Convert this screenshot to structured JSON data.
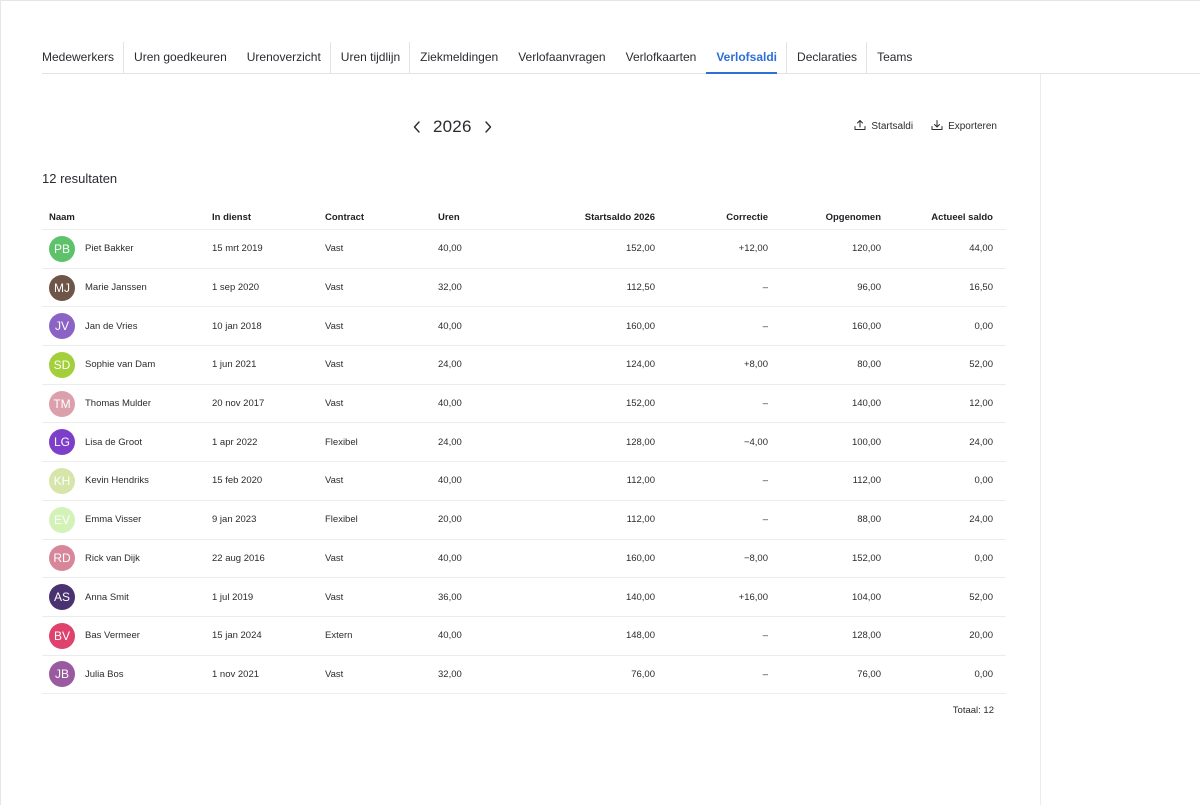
{
  "tabs": [
    {
      "label": "Medewerkers",
      "active": false,
      "separator": true
    },
    {
      "label": "Uren goedkeuren",
      "active": false,
      "separator": false
    },
    {
      "label": "Urenoverzicht",
      "active": false,
      "separator": true
    },
    {
      "label": "Uren tijdlijn",
      "active": false,
      "separator": true
    },
    {
      "label": "Ziekmeldingen",
      "active": false,
      "separator": false
    },
    {
      "label": "Verlofaanvragen",
      "active": false,
      "separator": false
    },
    {
      "label": "Verlofkaarten",
      "active": false,
      "separator": false
    },
    {
      "label": "Verlofsaldi",
      "active": true,
      "separator": true
    },
    {
      "label": "Declaraties",
      "active": false,
      "separator": true
    },
    {
      "label": "Teams",
      "active": false,
      "separator": false
    }
  ],
  "year_nav": {
    "year": "2026",
    "prev_icon": "chevron-left-icon",
    "next_icon": "chevron-right-icon"
  },
  "actions": {
    "startsaldi_label": "Startsaldi",
    "startsaldi_icon": "upload-icon",
    "export_label": "Exporteren",
    "export_icon": "download-icon"
  },
  "results_label": "12 resultaten",
  "table": {
    "headers": {
      "naam": "Naam",
      "in_dienst": "In dienst",
      "contract": "Contract",
      "uren": "Uren",
      "startsaldo": "Startsaldo 2026",
      "correctie": "Correctie",
      "opgenomen": "Opgenomen",
      "actueel": "Actueel saldo"
    },
    "rows": [
      {
        "initials": "PB",
        "color": "#5ec26a",
        "name": "Piet Bakker",
        "in_dienst": "15 mrt 2019",
        "contract": "Vast",
        "uren": "40,00",
        "startsaldo": "152,00",
        "correctie": "+12,00",
        "opgenomen": "120,00",
        "actueel": "44,00"
      },
      {
        "initials": "MJ",
        "color": "#6e5548",
        "name": "Marie Janssen",
        "in_dienst": "1 sep 2020",
        "contract": "Vast",
        "uren": "32,00",
        "startsaldo": "112,50",
        "correctie": "–",
        "opgenomen": "96,00",
        "actueel": "16,50"
      },
      {
        "initials": "JV",
        "color": "#8a63c4",
        "name": "Jan de Vries",
        "in_dienst": "10 jan 2018",
        "contract": "Vast",
        "uren": "40,00",
        "startsaldo": "160,00",
        "correctie": "–",
        "opgenomen": "160,00",
        "actueel": "0,00"
      },
      {
        "initials": "SD",
        "color": "#a3cf3a",
        "name": "Sophie van Dam",
        "in_dienst": "1 jun 2021",
        "contract": "Vast",
        "uren": "24,00",
        "startsaldo": "124,00",
        "correctie": "+8,00",
        "opgenomen": "80,00",
        "actueel": "52,00"
      },
      {
        "initials": "TM",
        "color": "#dca0ac",
        "name": "Thomas Mulder",
        "in_dienst": "20 nov 2017",
        "contract": "Vast",
        "uren": "40,00",
        "startsaldo": "152,00",
        "correctie": "–",
        "opgenomen": "140,00",
        "actueel": "12,00"
      },
      {
        "initials": "LG",
        "color": "#7d3fc9",
        "name": "Lisa de Groot",
        "in_dienst": "1 apr 2022",
        "contract": "Flexibel",
        "uren": "24,00",
        "startsaldo": "128,00",
        "correctie": "−4,00",
        "opgenomen": "100,00",
        "actueel": "24,00"
      },
      {
        "initials": "KH",
        "color": "#d6e5a9",
        "name": "Kevin Hendriks",
        "in_dienst": "15 feb 2020",
        "contract": "Vast",
        "uren": "40,00",
        "startsaldo": "112,00",
        "correctie": "–",
        "opgenomen": "112,00",
        "actueel": "0,00"
      },
      {
        "initials": "EV",
        "color": "#d2f2b8",
        "name": "Emma Visser",
        "in_dienst": "9 jan 2023",
        "contract": "Flexibel",
        "uren": "20,00",
        "startsaldo": "112,00",
        "correctie": "–",
        "opgenomen": "88,00",
        "actueel": "24,00"
      },
      {
        "initials": "RD",
        "color": "#d8869a",
        "name": "Rick van Dijk",
        "in_dienst": "22 aug 2016",
        "contract": "Vast",
        "uren": "40,00",
        "startsaldo": "160,00",
        "correctie": "−8,00",
        "opgenomen": "152,00",
        "actueel": "0,00"
      },
      {
        "initials": "AS",
        "color": "#4a3170",
        "name": "Anna Smit",
        "in_dienst": "1 jul 2019",
        "contract": "Vast",
        "uren": "36,00",
        "startsaldo": "140,00",
        "correctie": "+16,00",
        "opgenomen": "104,00",
        "actueel": "52,00"
      },
      {
        "initials": "BV",
        "color": "#e0426e",
        "name": "Bas Vermeer",
        "in_dienst": "15 jan 2024",
        "contract": "Extern",
        "uren": "40,00",
        "startsaldo": "148,00",
        "correctie": "–",
        "opgenomen": "128,00",
        "actueel": "20,00"
      },
      {
        "initials": "JB",
        "color": "#9a5aa0",
        "name": "Julia Bos",
        "in_dienst": "1 nov 2021",
        "contract": "Vast",
        "uren": "32,00",
        "startsaldo": "76,00",
        "correctie": "–",
        "opgenomen": "76,00",
        "actueel": "0,00"
      }
    ]
  },
  "total_label": "Totaal: 12",
  "colors": {
    "accent": "#2f6fd6",
    "divider": "#ececef"
  }
}
